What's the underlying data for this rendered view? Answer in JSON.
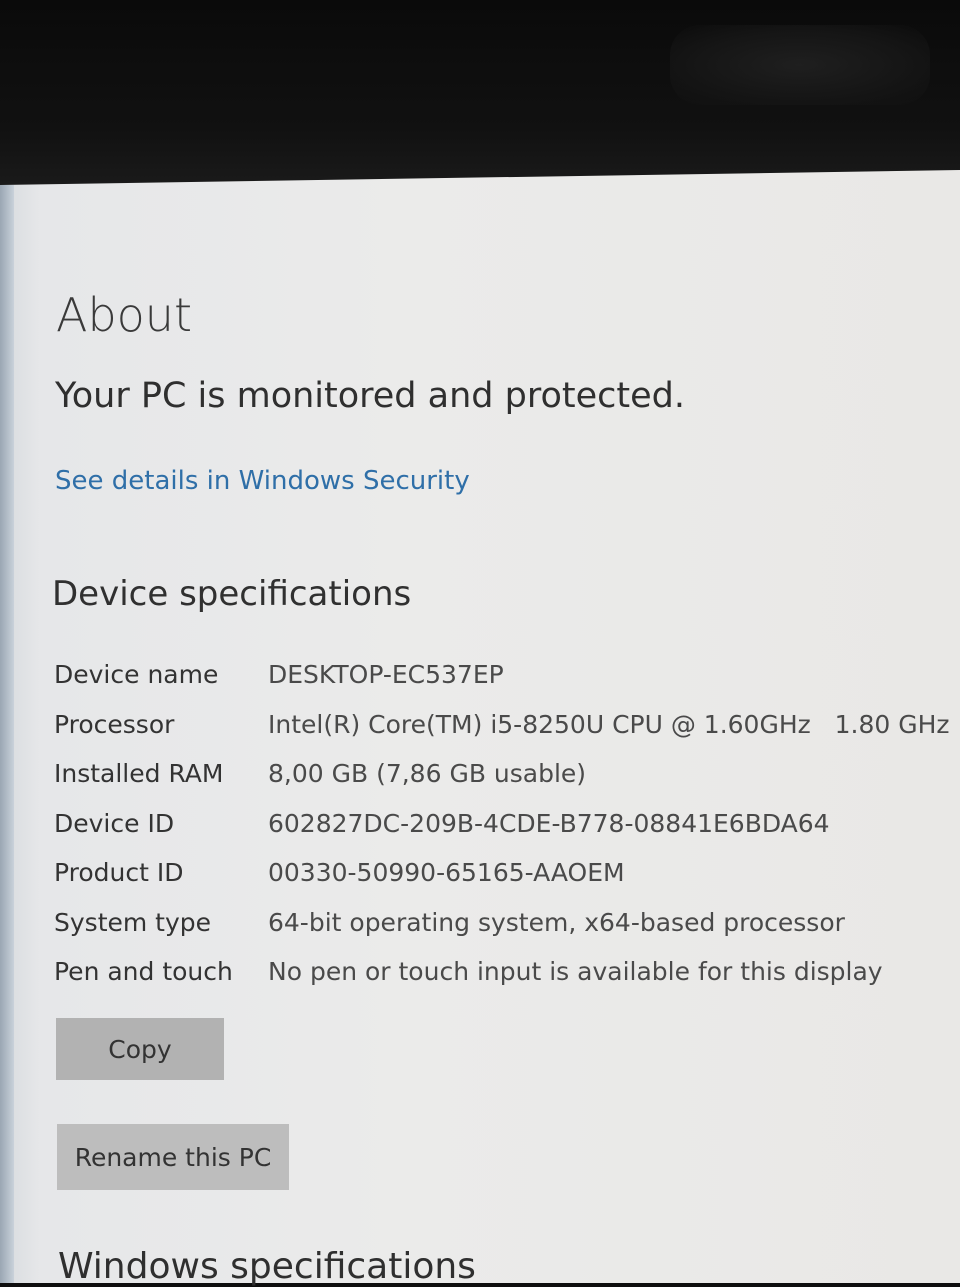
{
  "about": {
    "title": "About",
    "protection_message": "Your PC is monitored and protected.",
    "security_link": "See details in Windows Security"
  },
  "device_specifications": {
    "title": "Device specifications",
    "rows": [
      {
        "label": "Device name",
        "value": "DESKTOP-EC537EP"
      },
      {
        "label": "Processor",
        "value": "Intel(R) Core(TM) i5-8250U CPU @ 1.60GHz   1.80 GHz"
      },
      {
        "label": "Installed RAM",
        "value": "8,00 GB (7,86 GB usable)"
      },
      {
        "label": "Device ID",
        "value": "602827DC-209B-4CDE-B778-08841E6BDA64"
      },
      {
        "label": "Product ID",
        "value": "00330-50990-65165-AAOEM"
      },
      {
        "label": "System type",
        "value": "64-bit operating system, x64-based processor"
      },
      {
        "label": "Pen and touch",
        "value": "No pen or touch input is available for this display"
      }
    ],
    "copy_label": "Copy",
    "rename_label": "Rename this PC"
  },
  "windows_specifications": {
    "title": "Windows specifications"
  },
  "colors": {
    "link": "#2f6fa8",
    "button": "#b2b2b2",
    "background": "#ebebea"
  }
}
